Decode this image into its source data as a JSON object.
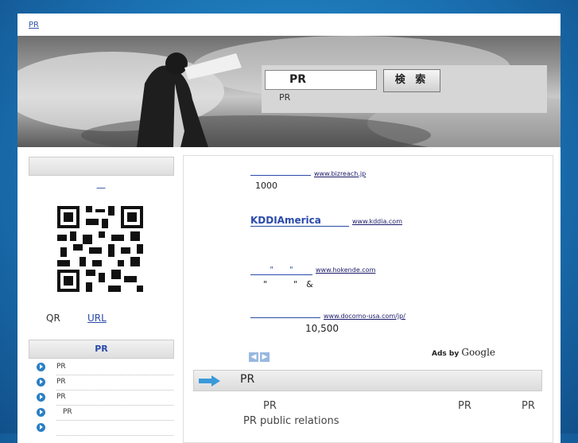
{
  "header": {
    "top_link": "PR"
  },
  "search": {
    "placeholder": "PR",
    "button_label": "検 索",
    "sub_text": "PR"
  },
  "sidebar": {
    "dash": "—",
    "qr_label": "QR",
    "url_link": "URL",
    "pr_heading": "PR",
    "items": [
      "PR",
      "PR",
      "PR",
      "PR",
      ""
    ]
  },
  "ads": [
    {
      "url": "www.bizreach.jp",
      "desc": "1000"
    },
    {
      "title": "KDDIAmerica",
      "url": "www.kddia.com"
    },
    {
      "title": "\"　　\"",
      "url": "www.hokende.com",
      "desc": "\"　　　\"　&"
    },
    {
      "url": "www.docomo-usa.com/jp/",
      "desc": "10,500"
    }
  ],
  "ads_by": {
    "label": "Ads by",
    "brand": "Google"
  },
  "main": {
    "section_title": "PR",
    "row1": [
      "PR",
      "PR",
      "PR"
    ],
    "row2": "PR public relations"
  },
  "colors": {
    "link": "#2a4aaa",
    "accent": "#2b7fc4",
    "background": "#1a6fb0"
  }
}
